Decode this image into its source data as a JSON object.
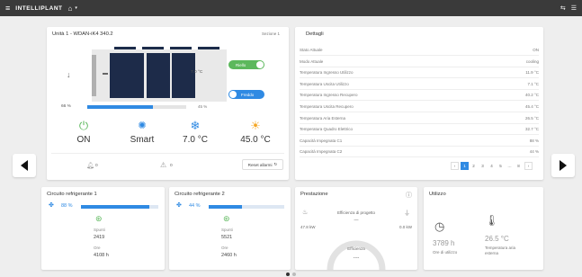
{
  "app": {
    "brand": "INTELLIPLANT",
    "home_icon": "home-icon",
    "topbar_right": [
      "⇆",
      "☰"
    ]
  },
  "unit": {
    "title": "Unità 1 - WDAN-iK4 340.2",
    "section_badge": "Sezione 1",
    "temp_mid": "7.0 °C",
    "percent_left": "66 %",
    "percent_right": "45 %",
    "fill_fraction": 0.66,
    "toggle_on_label": "Riello",
    "toggle_off_label": "Freddo",
    "icons": [
      {
        "icon": "power-icon",
        "value": "ON"
      },
      {
        "icon": "bulb-icon",
        "value": "Smart"
      },
      {
        "icon": "snowflake-icon",
        "value": "7.0 °C"
      },
      {
        "icon": "sun-icon",
        "value": "45.0 °C"
      }
    ],
    "alarm_bell_count": "0",
    "alarm_warn_count": "0",
    "reset_button": "Reset allarmi"
  },
  "details": {
    "title": "Dettagli",
    "rows": [
      {
        "label": "Stato Attuale",
        "value": "ON"
      },
      {
        "label": "Modo Attuale",
        "value": "cooling"
      },
      {
        "label": "Temperatura Ingresso Utilizzo",
        "value": "11.9 °C"
      },
      {
        "label": "Temperatura Uscita Utilizzo",
        "value": "7.1 °C"
      },
      {
        "label": "Temperatura Ingresso Recupero",
        "value": "40.2 °C"
      },
      {
        "label": "Temperatura Uscita Recupero",
        "value": "45.4 °C"
      },
      {
        "label": "Temperatura Aria Esterna",
        "value": "26.5 °C"
      },
      {
        "label": "Temperatura Quadro Elettrico",
        "value": "32.7 °C"
      },
      {
        "label": "Capacità Impegnata C1",
        "value": "88 %"
      },
      {
        "label": "Capacità Impegnata C2",
        "value": "44 %"
      }
    ],
    "pages": [
      "1",
      "2",
      "3",
      "4",
      "5",
      "…",
      "8"
    ],
    "active_page": "1"
  },
  "circuits": [
    {
      "title": "Circuito refrigerante 1",
      "percent": "88 %",
      "fraction": 0.88,
      "starts_label": "Spunti",
      "starts": "2419",
      "hours_label": "Ore",
      "hours": "4108 h"
    },
    {
      "title": "Circuito refrigerante 2",
      "percent": "44 %",
      "fraction": 0.44,
      "starts_label": "Spunti",
      "starts": "5521",
      "hours_label": "Ore",
      "hours": "2460 h"
    }
  ],
  "performance": {
    "title": "Prestazione",
    "efficiency_label": "Efficienza di progetto",
    "efficiency_value": "—",
    "power_left": "47.8 kW",
    "power_right": "0.0 kW",
    "gauge_label": "Efficienza",
    "gauge_value": "----"
  },
  "usage": {
    "title": "Utilizzo",
    "hours_value": "3789 h",
    "hours_label": "Ore di utilizzo",
    "temp_value": "26.5 °C",
    "temp_label": "Temperatura aria esterna"
  },
  "colors": {
    "green": "#5cb85c",
    "blue": "#2f8ae3",
    "orange": "#f5a623",
    "navy": "#1c2c4a"
  }
}
